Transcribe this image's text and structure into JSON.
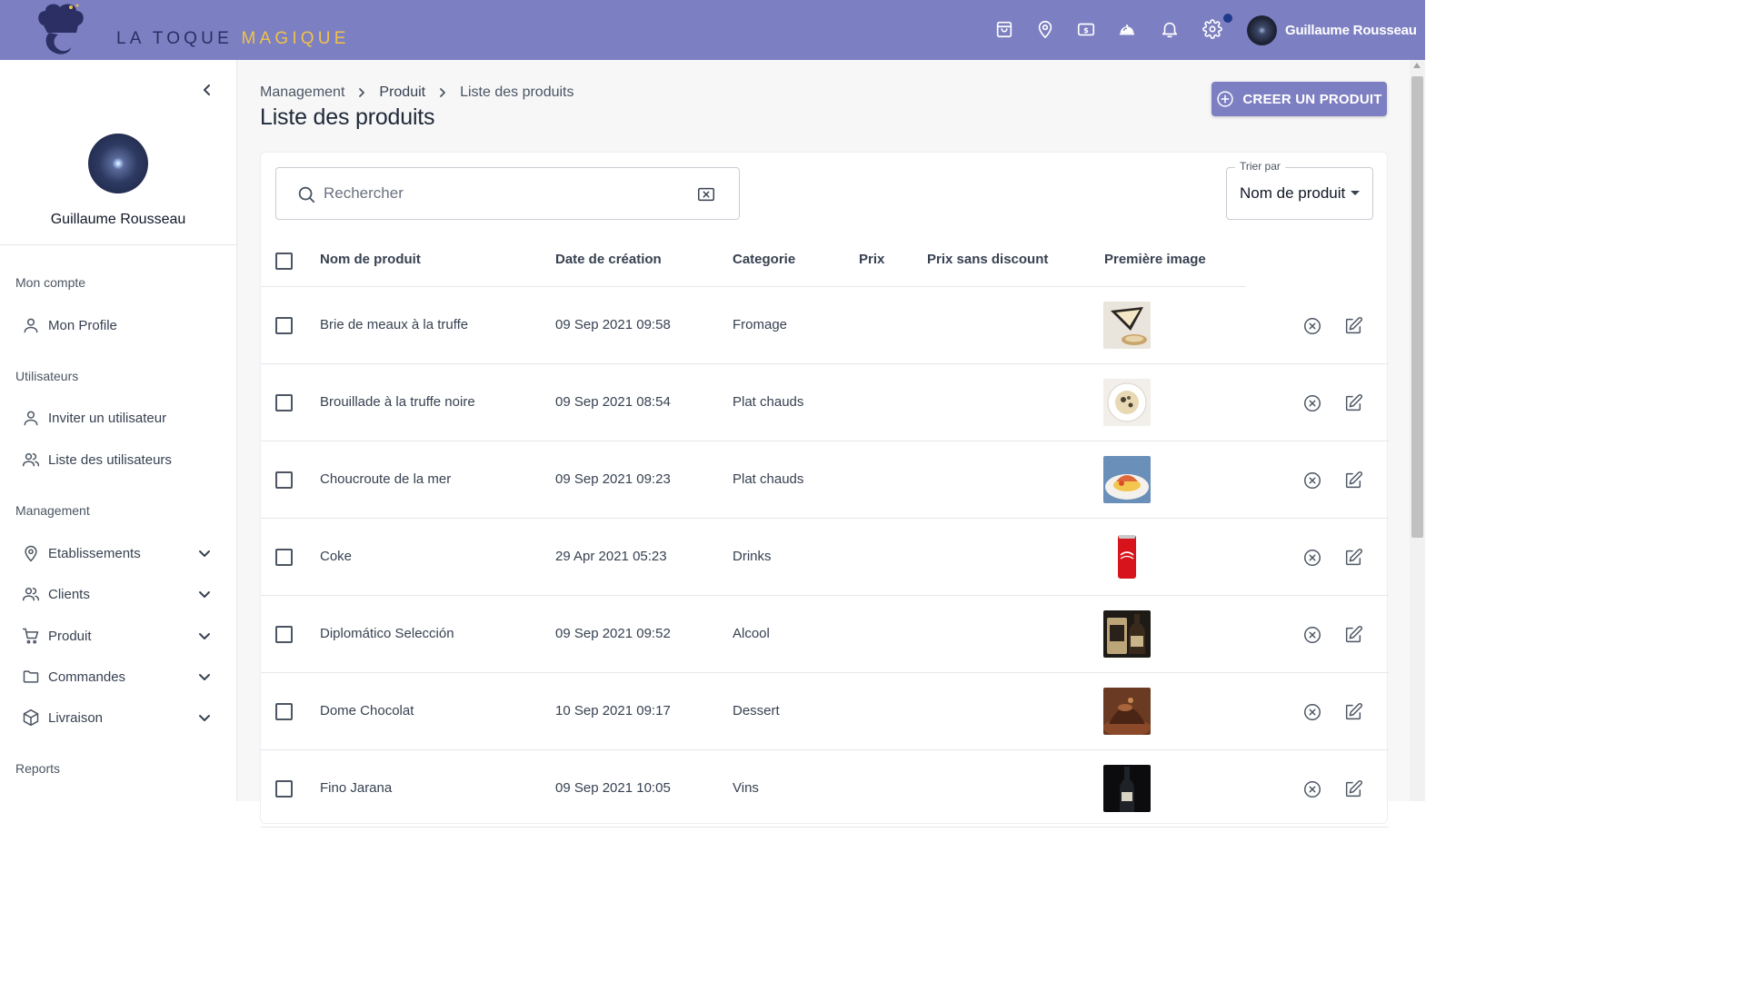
{
  "brand": {
    "word1": "LA TOQUE",
    "word2": "MAGIQUE"
  },
  "colors": {
    "accent": "#7c7fc1",
    "brand_dark": "#2b2f63",
    "brand_gold": "#f0c24a"
  },
  "topbar": {
    "icons": [
      "shopping-bag-icon",
      "map-pin-icon",
      "dollar-bill-icon",
      "cloche-icon",
      "bell-icon",
      "gear-icon"
    ],
    "user_name": "Guillaume Rousseau"
  },
  "sidebar": {
    "user_name": "Guillaume Rousseau",
    "sections": {
      "account": "Mon compte",
      "users": "Utilisateurs",
      "management": "Management",
      "reports": "Reports"
    },
    "items": {
      "profile": "Mon Profile",
      "invite": "Inviter un utilisateur",
      "user_list": "Liste des utilisateurs",
      "establishments": "Etablissements",
      "clients": "Clients",
      "product": "Produit",
      "orders": "Commandes",
      "delivery": "Livraison"
    }
  },
  "breadcrumb": [
    "Management",
    "Produit",
    "Liste des produits"
  ],
  "page_title": "Liste des produits",
  "create_button": "CREER UN PRODUIT",
  "search": {
    "placeholder": "Rechercher",
    "value": ""
  },
  "sort": {
    "label": "Trier par",
    "value": "Nom de produit"
  },
  "table": {
    "columns": [
      "Nom de produit",
      "Date de création",
      "Categorie",
      "Prix",
      "Prix sans discount",
      "Première image"
    ],
    "rows": [
      {
        "name": "Brie de meaux à la truffe",
        "date": "09 Sep 2021 09:58",
        "category": "Fromage",
        "price": "",
        "price_no_discount": "",
        "image": "cheese-image"
      },
      {
        "name": "Brouillade à la truffe noire",
        "date": "09 Sep 2021 08:54",
        "category": "Plat chauds",
        "price": "",
        "price_no_discount": "",
        "image": "scrambled-eggs-image"
      },
      {
        "name": "Choucroute de la mer",
        "date": "09 Sep 2021 09:23",
        "category": "Plat chauds",
        "price": "",
        "price_no_discount": "",
        "image": "seafood-dish-image"
      },
      {
        "name": "Coke",
        "date": "29 Apr 2021 05:23",
        "category": "Drinks",
        "price": "",
        "price_no_discount": "",
        "image": "coke-can-image"
      },
      {
        "name": "Diplomático Selección",
        "date": "09 Sep 2021 09:52",
        "category": "Alcool",
        "price": "",
        "price_no_discount": "",
        "image": "rum-bottle-image"
      },
      {
        "name": "Dome Chocolat",
        "date": "10 Sep 2021 09:17",
        "category": "Dessert",
        "price": "",
        "price_no_discount": "",
        "image": "chocolate-dome-image"
      },
      {
        "name": "Fino Jarana",
        "date": "09 Sep 2021 10:05",
        "category": "Vins",
        "price": "",
        "price_no_discount": "",
        "image": "wine-bottle-image"
      }
    ]
  }
}
